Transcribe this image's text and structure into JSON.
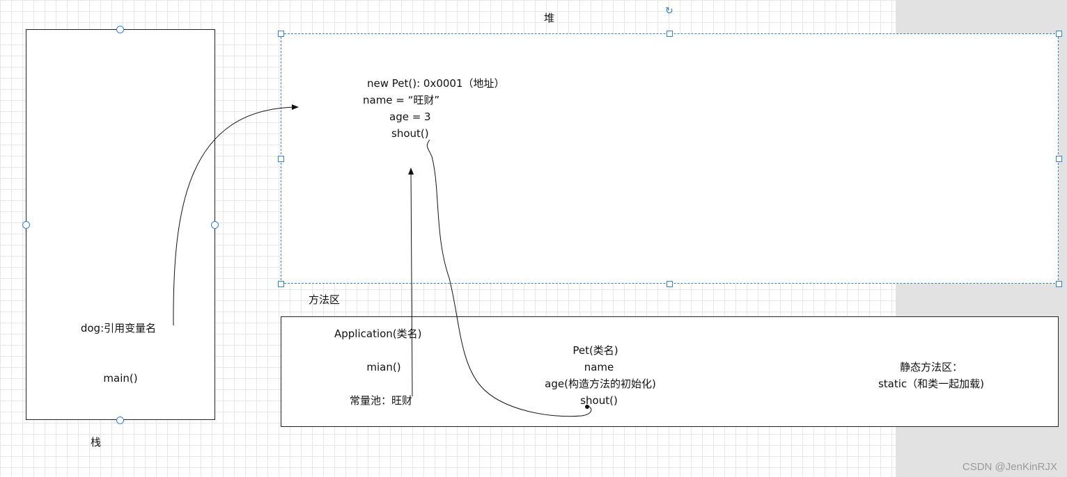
{
  "stack": {
    "title": "栈",
    "items": [
      "dog:引用变量名",
      "main()"
    ]
  },
  "heap": {
    "title": "堆",
    "object": {
      "line1": "new Pet():   0x0001（地址）",
      "line2": "name   =   “旺财”",
      "line3": "age = 3",
      "line4": "shout()"
    }
  },
  "method_area": {
    "title": "方法区",
    "application": {
      "name": "Application(类名)",
      "method": "mian()",
      "constant_pool": "常量池：旺财"
    },
    "pet": {
      "name": "Pet(类名)",
      "field": "name",
      "constructor": "age(构造方法的初始化)",
      "method": "shout()"
    },
    "static_area": {
      "title": "静态方法区：",
      "note": "static（和类一起加载)"
    }
  },
  "watermark": "CSDN @JenKinRJX",
  "colors": {
    "selection": "#2f7ed8",
    "outside_canvas": "#e2e2e2",
    "grid": "#e6e6e6"
  }
}
